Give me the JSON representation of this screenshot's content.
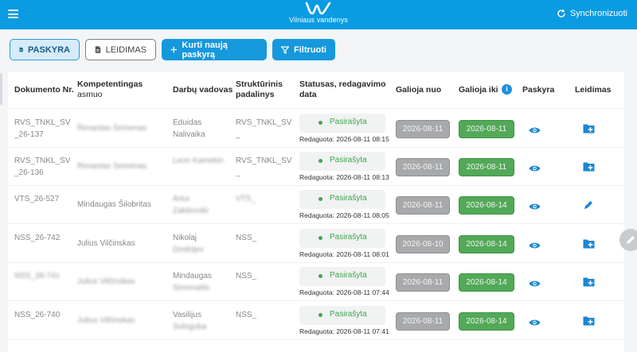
{
  "header": {
    "logo_text": "Vilniaus vandenys",
    "sync_label": "Synchronizuoti"
  },
  "toolbar": {
    "tab_paskyra": "PASKYRA",
    "tab_leidimas": "LEIDIMAS",
    "new_label": "Kurti naują paskyrą",
    "filter_label": "Filtruoti"
  },
  "table": {
    "columns": {
      "doc": "Dokumento Nr.",
      "person_1": "Kompetentingas",
      "person_2": "asmuo",
      "manager": "Darbų vadovas",
      "unit_1": "Struktūrinis",
      "unit_2": "padalinys",
      "status_1": "Statusas, redagavimo",
      "status_2": "data",
      "from": "Galioja nuo",
      "to": "Galioja iki",
      "paskyra": "Paskyra",
      "leidimas": "Leidimas"
    },
    "rows": [
      {
        "doc1": "RVS_TNKL_SV",
        "doc2": "_26-137",
        "person1": "Rimantas Semenas",
        "person2": "",
        "manager1": "Eduidas",
        "manager2": "Nalivaika",
        "unit1": "RVS_TNKL_SV",
        "unit2": "_",
        "status": "Pasirašyta",
        "edited": "Redaguota: 2026-08-11 08:15",
        "from": "2026-08-11",
        "to": "2026-08-11",
        "action": "add"
      },
      {
        "doc1": "RVS_TNKL_SV",
        "doc2": "_26-136",
        "person1": "Rimantas Semenas",
        "person2": "",
        "manager1": "Leon Kamekin",
        "manager2": "",
        "unit1": "RVS_TNKL_SV",
        "unit2": "_",
        "status": "Pasirašyta",
        "edited": "Redaguota: 2026-08-11 08:13",
        "from": "2026-08-11",
        "to": "2026-08-11",
        "action": "add"
      },
      {
        "doc1": "VTS_26-527",
        "doc2": "",
        "person1": "Mindaugas Šilobritas",
        "person2": "",
        "manager1": "Artur",
        "manager2": "Zakitovski",
        "unit1": "VTS_",
        "unit2": "",
        "status": "Pasirašyta",
        "edited": "Redaguota: 2026-08-11 08:05",
        "from": "2026-08-11",
        "to": "2026-08-14",
        "action": "edit"
      },
      {
        "doc1": "NSS_26-742",
        "doc2": "",
        "person1": "Julius Vilčinskas",
        "person2": "",
        "manager1": "Nikolaj",
        "manager2": "Dmitrijev",
        "unit1": "NSS_",
        "unit2": "",
        "status": "Pasirašyta",
        "edited": "Redaguota: 2026-08-11 08:01",
        "from": "2026-08-10",
        "to": "2026-08-14",
        "action": "add"
      },
      {
        "doc1": "NSS_26-741",
        "doc2": "",
        "person1": "Julius Vilčinskas",
        "person2": "",
        "manager1": "Mindaugas",
        "manager2": "Simonaitis",
        "unit1": "NSS_",
        "unit2": "",
        "status": "Pasirašyta",
        "edited": "Redaguota: 2026-08-11 07:44",
        "from": "2026-08-11",
        "to": "2026-08-14",
        "action": "add"
      },
      {
        "doc1": "NSS_26-740",
        "doc2": "",
        "person1": "Julius Vilčinskas",
        "person2": "",
        "manager1": "Vasilijus",
        "manager2": "Sologuba",
        "unit1": "NSS_",
        "unit2": "",
        "status": "Pasirašyta",
        "edited": "Redaguota: 2026-08-11 07:41",
        "from": "2026-08-11",
        "to": "2026-08-14",
        "action": "add"
      }
    ]
  },
  "colors": {
    "brand": "#0a9be2",
    "signed": "#3ea84d",
    "date_to": "#52a957",
    "date_from": "#a8a9ab",
    "action_icon": "#1a87d4"
  },
  "icons": [
    "menu-icon",
    "logo-icon",
    "sync-icon",
    "document-icon",
    "plus-icon",
    "filter-icon",
    "info-icon",
    "eye-icon",
    "folder-add-icon",
    "pencil-icon"
  ]
}
